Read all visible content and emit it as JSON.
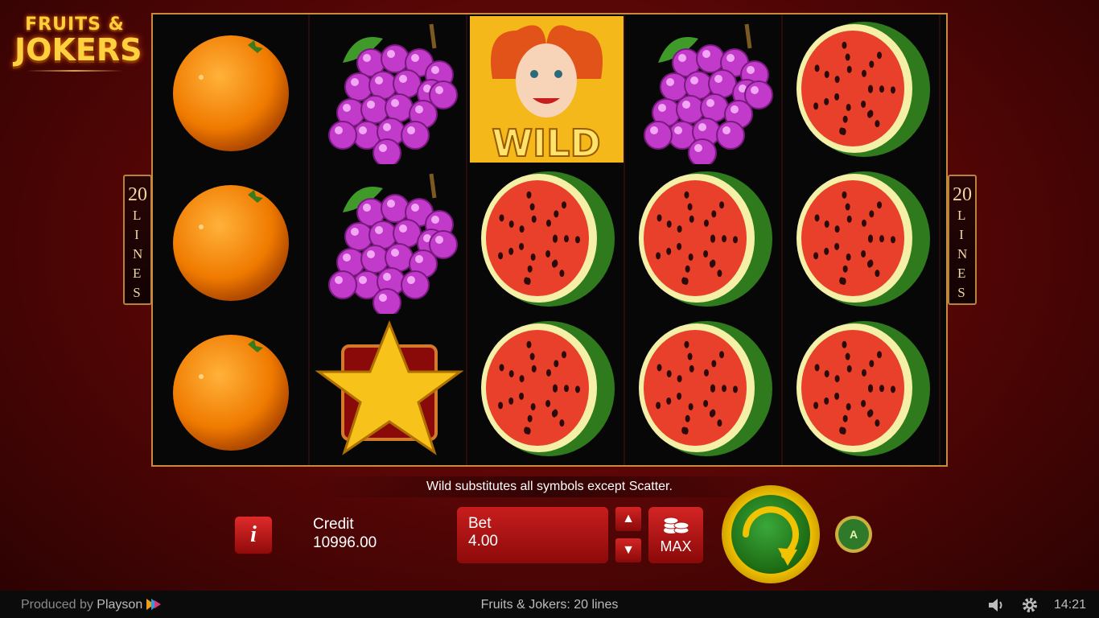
{
  "logo": {
    "line1": "FRUITS &",
    "line2": "JOKERS"
  },
  "paylines": {
    "left": {
      "count": "20",
      "word": "LINES"
    },
    "right": {
      "count": "20",
      "word": "LINES"
    }
  },
  "reels": [
    {
      "symbols": [
        "orange",
        "orange",
        "orange"
      ]
    },
    {
      "symbols": [
        "grapes",
        "grapes",
        "star"
      ]
    },
    {
      "symbols": [
        "wild",
        "watermelon",
        "watermelon"
      ]
    },
    {
      "symbols": [
        "grapes",
        "watermelon",
        "watermelon"
      ]
    },
    {
      "symbols": [
        "watermelon",
        "watermelon",
        "watermelon"
      ]
    }
  ],
  "wild_label": "WILD",
  "message": "Wild substitutes all symbols except Scatter.",
  "controls": {
    "info_icon": "info-icon",
    "credit_label": "Credit",
    "credit_value": "10996.00",
    "bet_label": "Bet",
    "bet_value": "4.00",
    "max_label": "MAX",
    "autoplay_label": "A"
  },
  "footer": {
    "produced_prefix": "Produced by",
    "produced_brand": "Playson",
    "title": "Fruits & Jokers: 20 lines",
    "time": "14:21"
  },
  "colors": {
    "accent": "#f2c300",
    "frame": "#c98a3a",
    "button_red": "#c81d1d",
    "spin_green": "#1c6a12"
  }
}
